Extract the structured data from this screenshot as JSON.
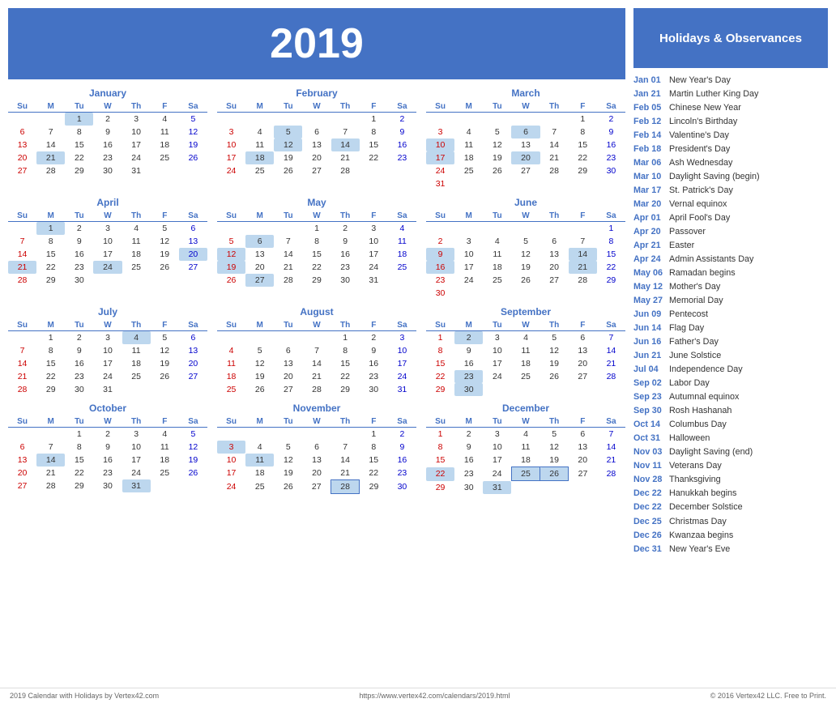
{
  "year": "2019",
  "title": "Holidays & Observances",
  "months": [
    {
      "name": "January",
      "days": [
        [
          null,
          null,
          1,
          2,
          3,
          4,
          5
        ],
        [
          6,
          7,
          8,
          9,
          10,
          11,
          12
        ],
        [
          13,
          14,
          15,
          16,
          17,
          18,
          19
        ],
        [
          20,
          21,
          22,
          23,
          24,
          25,
          26
        ],
        [
          27,
          28,
          29,
          30,
          31,
          null,
          null
        ]
      ],
      "highlighted": [
        1,
        21
      ],
      "outlined": []
    },
    {
      "name": "February",
      "days": [
        [
          null,
          null,
          null,
          null,
          null,
          1,
          2
        ],
        [
          3,
          4,
          5,
          6,
          7,
          8,
          9
        ],
        [
          10,
          11,
          12,
          13,
          14,
          15,
          16
        ],
        [
          17,
          18,
          19,
          20,
          21,
          22,
          23
        ],
        [
          24,
          25,
          26,
          27,
          28,
          null,
          null
        ]
      ],
      "highlighted": [
        5,
        12,
        14,
        18
      ],
      "outlined": []
    },
    {
      "name": "March",
      "days": [
        [
          null,
          null,
          null,
          null,
          null,
          1,
          2
        ],
        [
          3,
          4,
          5,
          6,
          7,
          8,
          9
        ],
        [
          10,
          11,
          12,
          13,
          14,
          15,
          16
        ],
        [
          17,
          18,
          19,
          20,
          21,
          22,
          23
        ],
        [
          24,
          25,
          26,
          27,
          28,
          29,
          30
        ],
        [
          31,
          null,
          null,
          null,
          null,
          null,
          null
        ]
      ],
      "highlighted": [
        6,
        10,
        17,
        20
      ],
      "outlined": []
    },
    {
      "name": "April",
      "days": [
        [
          null,
          1,
          2,
          3,
          4,
          5,
          6
        ],
        [
          7,
          8,
          9,
          10,
          11,
          12,
          13
        ],
        [
          14,
          15,
          16,
          17,
          18,
          19,
          20
        ],
        [
          21,
          22,
          23,
          24,
          25,
          26,
          27
        ],
        [
          28,
          29,
          30,
          null,
          null,
          null,
          null
        ]
      ],
      "highlighted": [
        1,
        20,
        21,
        24
      ],
      "outlined": []
    },
    {
      "name": "May",
      "days": [
        [
          null,
          null,
          null,
          1,
          2,
          3,
          4
        ],
        [
          5,
          6,
          7,
          8,
          9,
          10,
          11
        ],
        [
          12,
          13,
          14,
          15,
          16,
          17,
          18
        ],
        [
          19,
          20,
          21,
          22,
          23,
          24,
          25
        ],
        [
          26,
          27,
          28,
          29,
          30,
          31,
          null
        ]
      ],
      "highlighted": [
        6,
        12,
        19,
        27
      ],
      "outlined": []
    },
    {
      "name": "June",
      "days": [
        [
          null,
          null,
          null,
          null,
          null,
          null,
          1
        ],
        [
          2,
          3,
          4,
          5,
          6,
          7,
          8
        ],
        [
          9,
          10,
          11,
          12,
          13,
          14,
          15
        ],
        [
          16,
          17,
          18,
          19,
          20,
          21,
          22
        ],
        [
          23,
          24,
          25,
          26,
          27,
          28,
          29
        ],
        [
          30,
          null,
          null,
          null,
          null,
          null,
          null
        ]
      ],
      "highlighted": [
        9,
        14,
        16,
        21
      ],
      "outlined": []
    },
    {
      "name": "July",
      "days": [
        [
          null,
          1,
          2,
          3,
          4,
          5,
          6
        ],
        [
          7,
          8,
          9,
          10,
          11,
          12,
          13
        ],
        [
          14,
          15,
          16,
          17,
          18,
          19,
          20
        ],
        [
          21,
          22,
          23,
          24,
          25,
          26,
          27
        ],
        [
          28,
          29,
          30,
          31,
          null,
          null,
          null
        ]
      ],
      "highlighted": [
        4
      ],
      "outlined": []
    },
    {
      "name": "August",
      "days": [
        [
          null,
          null,
          null,
          null,
          1,
          2,
          3
        ],
        [
          4,
          5,
          6,
          7,
          8,
          9,
          10
        ],
        [
          11,
          12,
          13,
          14,
          15,
          16,
          17
        ],
        [
          18,
          19,
          20,
          21,
          22,
          23,
          24
        ],
        [
          25,
          26,
          27,
          28,
          29,
          30,
          31
        ]
      ],
      "highlighted": [],
      "outlined": []
    },
    {
      "name": "September",
      "days": [
        [
          1,
          2,
          3,
          4,
          5,
          6,
          7
        ],
        [
          8,
          9,
          10,
          11,
          12,
          13,
          14
        ],
        [
          15,
          16,
          17,
          18,
          19,
          20,
          21
        ],
        [
          22,
          23,
          24,
          25,
          26,
          27,
          28
        ],
        [
          29,
          30,
          null,
          null,
          null,
          null,
          null
        ]
      ],
      "highlighted": [
        2,
        23,
        30
      ],
      "outlined": []
    },
    {
      "name": "October",
      "days": [
        [
          null,
          null,
          1,
          2,
          3,
          4,
          5
        ],
        [
          6,
          7,
          8,
          9,
          10,
          11,
          12
        ],
        [
          13,
          14,
          15,
          16,
          17,
          18,
          19
        ],
        [
          20,
          21,
          22,
          23,
          24,
          25,
          26
        ],
        [
          27,
          28,
          29,
          30,
          31,
          null,
          null
        ]
      ],
      "highlighted": [
        14,
        31
      ],
      "outlined": []
    },
    {
      "name": "November",
      "days": [
        [
          null,
          null,
          null,
          null,
          null,
          1,
          2
        ],
        [
          3,
          4,
          5,
          6,
          7,
          8,
          9
        ],
        [
          10,
          11,
          12,
          13,
          14,
          15,
          16
        ],
        [
          17,
          18,
          19,
          20,
          21,
          22,
          23
        ],
        [
          24,
          25,
          26,
          27,
          28,
          29,
          30
        ]
      ],
      "highlighted": [
        3,
        11,
        28
      ],
      "outlined": [
        28
      ]
    },
    {
      "name": "December",
      "days": [
        [
          1,
          2,
          3,
          4,
          5,
          6,
          7
        ],
        [
          8,
          9,
          10,
          11,
          12,
          13,
          14
        ],
        [
          15,
          16,
          17,
          18,
          19,
          20,
          21
        ],
        [
          22,
          23,
          24,
          25,
          26,
          27,
          28
        ],
        [
          29,
          30,
          31,
          null,
          null,
          null,
          null
        ]
      ],
      "highlighted": [
        22,
        25,
        26,
        31
      ],
      "outlined": [
        25,
        26
      ]
    }
  ],
  "holidays": [
    {
      "date": "Jan 01",
      "name": "New Year's Day"
    },
    {
      "date": "Jan 21",
      "name": "Martin Luther King Day"
    },
    {
      "date": "Feb 05",
      "name": "Chinese New Year"
    },
    {
      "date": "Feb 12",
      "name": "Lincoln's Birthday"
    },
    {
      "date": "Feb 14",
      "name": "Valentine's Day"
    },
    {
      "date": "Feb 18",
      "name": "President's Day"
    },
    {
      "date": "Mar 06",
      "name": "Ash Wednesday"
    },
    {
      "date": "Mar 10",
      "name": "Daylight Saving (begin)"
    },
    {
      "date": "Mar 17",
      "name": "St. Patrick's Day"
    },
    {
      "date": "Mar 20",
      "name": "Vernal equinox"
    },
    {
      "date": "Apr 01",
      "name": "April Fool's Day"
    },
    {
      "date": "Apr 20",
      "name": "Passover"
    },
    {
      "date": "Apr 21",
      "name": "Easter"
    },
    {
      "date": "Apr 24",
      "name": "Admin Assistants Day"
    },
    {
      "date": "May 06",
      "name": "Ramadan begins"
    },
    {
      "date": "May 12",
      "name": "Mother's Day"
    },
    {
      "date": "May 27",
      "name": "Memorial Day"
    },
    {
      "date": "Jun 09",
      "name": "Pentecost"
    },
    {
      "date": "Jun 14",
      "name": "Flag Day"
    },
    {
      "date": "Jun 16",
      "name": "Father's Day"
    },
    {
      "date": "Jun 21",
      "name": "June Solstice"
    },
    {
      "date": "Jul 04",
      "name": "Independence Day"
    },
    {
      "date": "Sep 02",
      "name": "Labor Day"
    },
    {
      "date": "Sep 23",
      "name": "Autumnal equinox"
    },
    {
      "date": "Sep 30",
      "name": "Rosh Hashanah"
    },
    {
      "date": "Oct 14",
      "name": "Columbus Day"
    },
    {
      "date": "Oct 31",
      "name": "Halloween"
    },
    {
      "date": "Nov 03",
      "name": "Daylight Saving (end)"
    },
    {
      "date": "Nov 11",
      "name": "Veterans Day"
    },
    {
      "date": "Nov 28",
      "name": "Thanksgiving"
    },
    {
      "date": "Dec 22",
      "name": "Hanukkah begins"
    },
    {
      "date": "Dec 22",
      "name": "December Solstice"
    },
    {
      "date": "Dec 25",
      "name": "Christmas Day"
    },
    {
      "date": "Dec 26",
      "name": "Kwanzaa begins"
    },
    {
      "date": "Dec 31",
      "name": "New Year's Eve"
    }
  ],
  "footer": {
    "left": "2019 Calendar with Holidays by Vertex42.com",
    "center": "https://www.vertex42.com/calendars/2019.html",
    "right": "© 2016 Vertex42 LLC. Free to Print."
  },
  "weekdays": [
    "Su",
    "M",
    "Tu",
    "W",
    "Th",
    "F",
    "Sa"
  ]
}
